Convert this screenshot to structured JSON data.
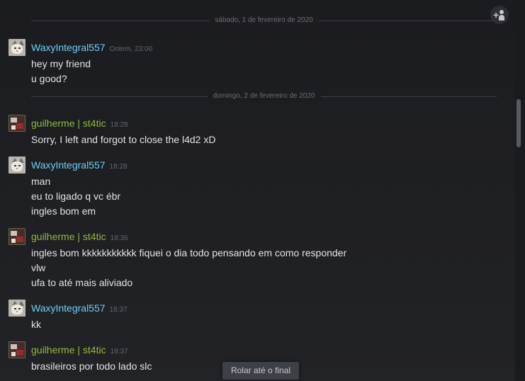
{
  "date_separators": [
    "sábado, 1 de fevereiro de 2020",
    "domingo, 2 de fevereiro de 2020"
  ],
  "messages": [
    {
      "user": "WaxyIntegral557",
      "time": "Ontem, 23:00",
      "lines": [
        "hey my friend",
        "u good?"
      ]
    },
    {
      "user": "guilherme | st4tic",
      "time": "18:28",
      "lines": [
        "Sorry, I left and forgot to close the l4d2 xD"
      ]
    },
    {
      "user": "WaxyIntegral557",
      "time": "18:28",
      "lines": [
        "man",
        "eu to ligado q vc ébr",
        "ingles bom em"
      ]
    },
    {
      "user": "guilherme | st4tic",
      "time": "18:36",
      "lines": [
        "ingles bom kkkkkkkkkkk fiquei o dia todo pensando em como responder",
        "vlw",
        "ufa to até mais aliviado"
      ]
    },
    {
      "user": "WaxyIntegral557",
      "time": "18:37",
      "lines": [
        "kk"
      ]
    },
    {
      "user": "guilherme | st4tic",
      "time": "18:37",
      "lines": [
        "brasileiros por todo lado slc"
      ]
    }
  ],
  "scroll_to_bottom_label": "Rolar até o final",
  "icons": {
    "add_friend": "add-friend-icon",
    "avatar_waxy": "cat-avatar",
    "avatar_guilherme": "custom-avatar"
  },
  "colors": {
    "friend_name": "#6dcff6",
    "self_name": "#90ba3c",
    "background": "#1e1f23"
  }
}
